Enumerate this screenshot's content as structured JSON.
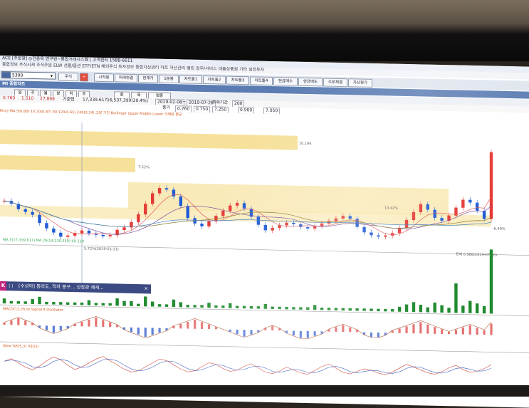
{
  "app": {
    "title": "ACE [주문창] ◎전종목 연구원~통합거래시스템 | 고객센터 1588-6611",
    "menu": "종합정보 주식시세 주식주문 ELW 선물/옵션 ETF/ETN 해외주식 투자정보 종합자산관리 차트 자산관리 뱅킹 업무/서비스 대출상품권 기타 실전투자"
  },
  "toolbar": {
    "code": "5300",
    "buttons": [
      "주식",
      "+",
      "시작봉",
      "미래연결",
      "현재가",
      "1분봉",
      "차트툴1",
      "차트툴2",
      "차트툴3",
      "차트툴4",
      "현금매수",
      "현금매도",
      "주문체결",
      "자산평가"
    ]
  },
  "window": {
    "title": "MI 종합차트"
  },
  "tabs": [
    "일",
    "주",
    "월",
    "분",
    "틱",
    "초",
    "종",
    "목",
    "업종"
  ],
  "info": {
    "row1": [
      "0.760",
      "1.510",
      "27,868",
      "기준탭",
      "17,339.617",
      "16,537,399(20.4%)",
      "2019-02-08",
      "~",
      "2019-07-26",
      "조회기간",
      "200"
    ],
    "row2": [
      "종가",
      "0.760",
      "0.750",
      "7.250",
      "0.900",
      "7.050"
    ]
  },
  "legend": {
    "price": "Price MA 5(0.80) 10 20(0.87) 60 120(0.65) 240(0.24) 고분 기간 Bollinger Upper Middle Lower 거래량 평균",
    "volume": "MA 5(17,339.617) MA 20(14,230.550) 60 120",
    "macd": "MACD(12,26,9) Signal 9 Oscillator",
    "stoch": "Slow %K(5,3) %D(3)"
  },
  "price_labels": {
    "high": "10.194",
    "mid1": "7.52%",
    "mid2": "13.42%",
    "mid3": "-6.49%",
    "low": "5.72%(2019-03-11)",
    "current": "현재 6.988(2019-07-26)"
  },
  "news": {
    "badge": "K",
    "nav": "⟨ ⟩",
    "text": "[수성아] 동리도, 적자 봉구... 성장관 쇄새...",
    "close": "×"
  },
  "colors": {
    "up": "#e53935",
    "down": "#1e5bd6",
    "volume": "#1f8a2e",
    "band": "#f5dc8a",
    "macd_pos": "#e57373",
    "macd_neg": "#5c7fd6"
  },
  "chart_data": {
    "type": "line",
    "candles_close": [
      0.86,
      0.84,
      0.8,
      0.78,
      0.76,
      0.7,
      0.66,
      0.63,
      0.6,
      0.61,
      0.63,
      0.65,
      0.63,
      0.62,
      0.61,
      0.62,
      0.66,
      0.68,
      0.72,
      0.78,
      0.86,
      0.94,
      0.98,
      0.97,
      0.92,
      0.85,
      0.76,
      0.72,
      0.7,
      0.74,
      0.78,
      0.82,
      0.86,
      0.88,
      0.84,
      0.78,
      0.72,
      0.68,
      0.7,
      0.72,
      0.74,
      0.73,
      0.71,
      0.7,
      0.72,
      0.74,
      0.76,
      0.78,
      0.8,
      0.78,
      0.72,
      0.68,
      0.66,
      0.65,
      0.66,
      0.68,
      0.72,
      0.78,
      0.84,
      0.9,
      0.86,
      0.8,
      0.78,
      0.82,
      0.88,
      0.94,
      0.92,
      0.86,
      0.8,
      1.3
    ],
    "volume": [
      2,
      1,
      1,
      1,
      2,
      3,
      1,
      1,
      1,
      1,
      1,
      1,
      2,
      1,
      1,
      1,
      3,
      2,
      2,
      1,
      4,
      2,
      1,
      1,
      3,
      2,
      1,
      1,
      1,
      2,
      1,
      1,
      2,
      1,
      1,
      1,
      1,
      2,
      1,
      1,
      1,
      1,
      1,
      1,
      2,
      1,
      1,
      1,
      1,
      1,
      1,
      1,
      1,
      1,
      1,
      1,
      2,
      3,
      4,
      3,
      2,
      4,
      3,
      2,
      12,
      3,
      5,
      4,
      3,
      26
    ],
    "macd": [
      1,
      2,
      3,
      2,
      1,
      -1,
      -2,
      -3,
      -2,
      -1,
      1,
      2,
      3,
      4,
      3,
      2,
      1,
      -1,
      -2,
      -3,
      -4,
      -3,
      -2,
      -1,
      1,
      2,
      3,
      4,
      3,
      2,
      1,
      0,
      -1,
      -2,
      -3,
      -2,
      -1,
      1,
      2,
      1,
      -1,
      -2,
      -3,
      -3,
      -2,
      -1,
      1,
      2,
      3,
      2,
      1,
      -1,
      -2,
      -2,
      -1,
      1,
      2,
      3,
      4,
      5,
      4,
      3,
      2,
      1,
      2,
      3,
      4,
      3,
      2,
      5
    ],
    "stoch": [
      60,
      70,
      55,
      40,
      30,
      45,
      65,
      80,
      70,
      50,
      35,
      45,
      60,
      75,
      85,
      70,
      55,
      40,
      30,
      35,
      50,
      65,
      80,
      75,
      60,
      45,
      35,
      40,
      55,
      70,
      65,
      50,
      40,
      45,
      60,
      70,
      55,
      40,
      35,
      45,
      60,
      50,
      40,
      35,
      50,
      65,
      75,
      60,
      45,
      40,
      50,
      60,
      55,
      45,
      40,
      50,
      65,
      80,
      70,
      60,
      50,
      45,
      55,
      70,
      80,
      65,
      55,
      60,
      70,
      85
    ]
  }
}
